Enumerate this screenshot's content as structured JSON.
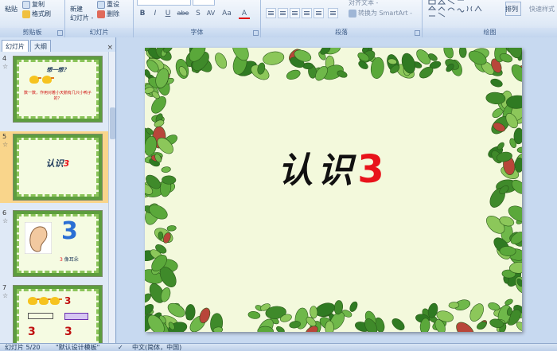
{
  "ribbon": {
    "clipboard": {
      "label": "剪贴板",
      "paste": "粘贴",
      "copy": "复制",
      "format_painter": "格式刷"
    },
    "slides": {
      "label": "幻灯片",
      "new_slide": "新建",
      "new_slide_2": "幻灯片 -",
      "reset": "重设",
      "delete": "删除"
    },
    "font": {
      "label": "字体",
      "bold": "B",
      "italic": "I",
      "underline": "U",
      "strike": "abe",
      "shadow": "S",
      "spacing": "AV",
      "case": "Aa",
      "color": "A"
    },
    "paragraph": {
      "label": "段落",
      "align_text": "对齐文本 -",
      "convert_smartart": "转换为 SmartArt -"
    },
    "drawing": {
      "label": "绘图",
      "arrange": "排列",
      "quick_styles": "快速样式"
    }
  },
  "panel": {
    "tabs": [
      "幻灯片",
      "大纲"
    ],
    "close": "×",
    "thumbnails": [
      {
        "number": "4",
        "title": "想一想？",
        "caption": "数一数，作用对着小天鹅有几只小鸭子的？",
        "selected": false
      },
      {
        "number": "5",
        "title": "认识",
        "title_num": "3",
        "selected": true
      },
      {
        "number": "6",
        "big_num": "3",
        "caption_num": "3",
        "caption": "像耳朵",
        "selected": false
      },
      {
        "number": "7",
        "num_a": "3",
        "num_b": "3",
        "num_c": "3",
        "selected": false
      }
    ],
    "star": "☆"
  },
  "slide": {
    "title": "认识",
    "title_num": "3"
  },
  "status": {
    "slide_count": "幻灯片 5/20",
    "theme": "\"默认设计模板\"",
    "language": "中文(简体，中国)"
  },
  "colors": {
    "leaf_dark": "#3f8a2a",
    "leaf_light": "#8cc75a",
    "leaf_red": "#b8463a",
    "slide_bg": "#f3f9dc",
    "title_num": "#e8131b"
  }
}
